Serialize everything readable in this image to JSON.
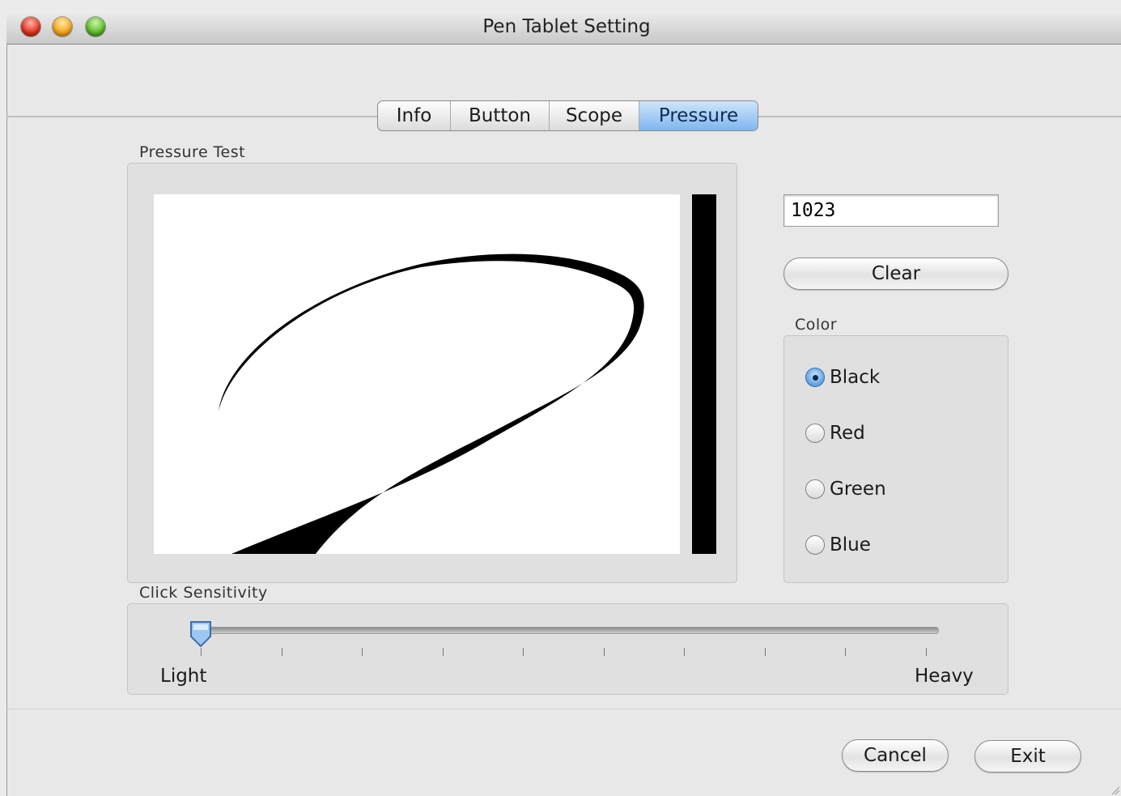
{
  "window": {
    "title": "Pen Tablet Setting"
  },
  "tabs": [
    {
      "label": "Info",
      "active": false
    },
    {
      "label": "Button",
      "active": false
    },
    {
      "label": "Scope",
      "active": false
    },
    {
      "label": "Pressure",
      "active": true
    }
  ],
  "pressure_test": {
    "group_label": "Pressure Test",
    "meter_level": 1.0
  },
  "pressure_value": "1023",
  "clear_label": "Clear",
  "color_group": {
    "label": "Color",
    "options": [
      {
        "label": "Black",
        "selected": true
      },
      {
        "label": "Red",
        "selected": false
      },
      {
        "label": "Green",
        "selected": false
      },
      {
        "label": "Blue",
        "selected": false
      }
    ]
  },
  "click_sensitivity": {
    "label": "Click Sensitivity",
    "min_label": "Light",
    "max_label": "Heavy",
    "tick_count": 10,
    "value_index": 0
  },
  "footer": {
    "cancel_label": "Cancel",
    "exit_label": "Exit"
  },
  "colors": {
    "tab_active": "#7fb6ee",
    "radio_selected": "#5a9ee6",
    "stroke": "#000000"
  }
}
